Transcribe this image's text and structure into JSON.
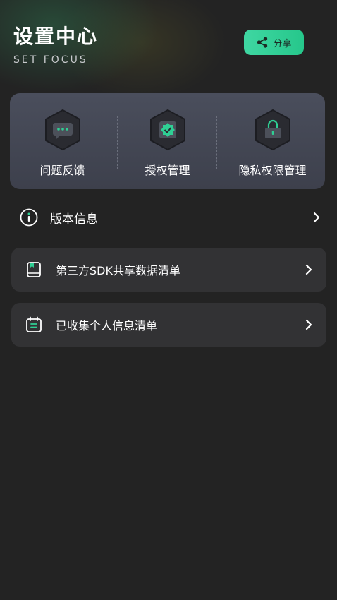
{
  "header": {
    "title": "设置中心",
    "subtitle": "SET FOCUS",
    "share_label": "分享"
  },
  "quick_actions": [
    {
      "label": "问题反馈",
      "icon": "chat-bubble-icon"
    },
    {
      "label": "授权管理",
      "icon": "verified-badge-icon"
    },
    {
      "label": "隐私权限管理",
      "icon": "lock-icon"
    }
  ],
  "menu": {
    "version_info": {
      "label": "版本信息",
      "icon": "info-icon"
    },
    "third_party_sdk": {
      "label": "第三方SDK共享数据清单",
      "icon": "book-icon"
    },
    "personal_info": {
      "label": "已收集个人信息清单",
      "icon": "calendar-list-icon"
    }
  },
  "colors": {
    "background": "#232323",
    "accent": "#2fcf94",
    "card": "#323234",
    "quick_card": "#434653"
  }
}
